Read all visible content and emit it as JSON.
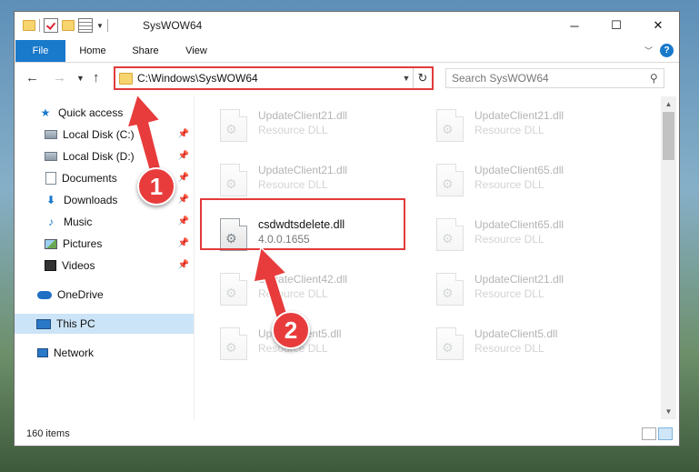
{
  "window": {
    "title": "SysWOW64",
    "controls": {
      "minimize": "─",
      "maximize": "☐",
      "close": "✕"
    }
  },
  "ribbon": {
    "tabs": [
      "File",
      "Home",
      "Share",
      "View"
    ],
    "help": "?"
  },
  "address": {
    "path": "C:\\Windows\\SysWOW64",
    "search_placeholder": "Search SysWOW64"
  },
  "nav": {
    "quick_access": "Quick access",
    "items": [
      {
        "label": "Local Disk (C:)",
        "icon": "drive-icon",
        "pinned": true
      },
      {
        "label": "Local Disk (D:)",
        "icon": "drive-icon",
        "pinned": true
      },
      {
        "label": "Documents",
        "icon": "documents-icon",
        "pinned": true
      },
      {
        "label": "Downloads",
        "icon": "download-icon",
        "pinned": true
      },
      {
        "label": "Music",
        "icon": "music-icon",
        "pinned": true
      },
      {
        "label": "Pictures",
        "icon": "pictures-icon",
        "pinned": true
      },
      {
        "label": "Videos",
        "icon": "videos-icon",
        "pinned": true
      }
    ],
    "onedrive": "OneDrive",
    "this_pc": "This PC",
    "network": "Network"
  },
  "files": [
    {
      "name": "UpdateClient21.dll",
      "desc": "Resource DLL"
    },
    {
      "name": "UpdateClient21.dll",
      "desc": "Resource DLL"
    },
    {
      "name": "UpdateClient21.dll",
      "desc": "Resource DLL"
    },
    {
      "name": "UpdateClient65.dll",
      "desc": "Resource DLL"
    },
    {
      "name": "csdwdtsdelete.dll",
      "desc": "4.0.0.1655"
    },
    {
      "name": "UpdateClient65.dll",
      "desc": "Resource DLL"
    },
    {
      "name": "UpdateClient42.dll",
      "desc": "Resource DLL"
    },
    {
      "name": "UpdateClient21.dll",
      "desc": "Resource DLL"
    },
    {
      "name": "UpdateClient5.dll",
      "desc": "Resource DLL"
    },
    {
      "name": "UpdateClient5.dll",
      "desc": "Resource DLL"
    }
  ],
  "status": {
    "item_count": "160 items"
  },
  "callouts": {
    "step1": "1",
    "step2": "2"
  },
  "colors": {
    "accent": "#1979ca",
    "highlight": "#e23a3a",
    "selected": "#cce4f7"
  }
}
